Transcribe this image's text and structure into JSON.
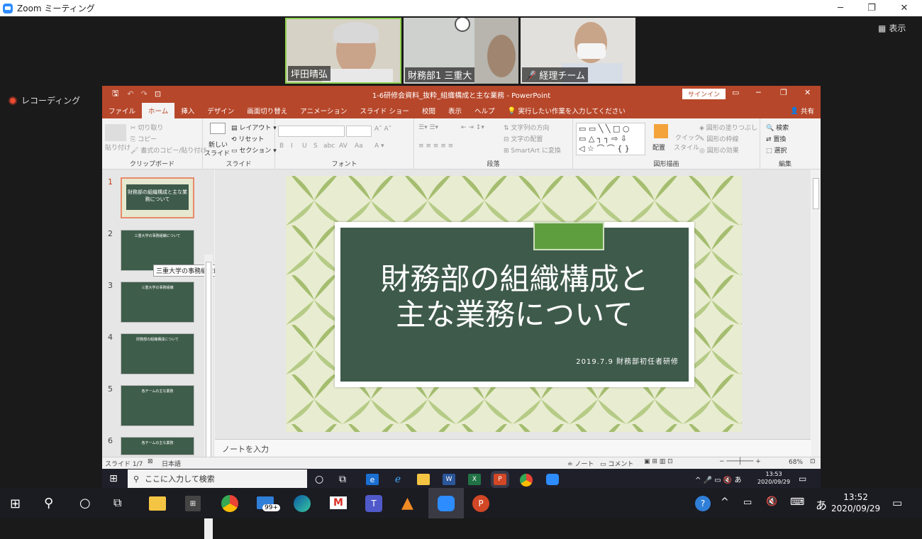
{
  "zoom": {
    "title": "Zoom ミーティング",
    "view_button": "表示",
    "recording": "レコーディング"
  },
  "participants": [
    {
      "name": "坪田晴弘"
    },
    {
      "name": "財務部1 三重大"
    },
    {
      "name": "経理チーム"
    }
  ],
  "pp": {
    "doc_title": "1-6研修会資料_抜粋_組織構成と主な業務  -  PowerPoint",
    "signin": "サインイン",
    "tabs": [
      "ファイル",
      "ホーム",
      "挿入",
      "デザイン",
      "画面切り替え",
      "アニメーション",
      "スライド ショー",
      "校閲",
      "表示",
      "ヘルプ"
    ],
    "tellme": "実行したい作業を入力してください",
    "share": "共有",
    "ribbon": {
      "clipboard": {
        "paste": "貼り付け",
        "cut": "切り取り",
        "copy": "コピー",
        "format_painter": "書式のコピー/貼り付け",
        "label": "クリップボード"
      },
      "slides": {
        "new_slide": "新しい",
        "new_slide2": "スライド",
        "layout": "レイアウト",
        "reset": "リセット",
        "section": "セクション",
        "label": "スライド"
      },
      "font": {
        "label": "フォント",
        "bold": "B",
        "italic": "I",
        "underline": "U",
        "shadow": "S",
        "strike": "abc",
        "spacing": "AV",
        "case": "Aa"
      },
      "paragraph": {
        "label": "段落",
        "text_dir": "文字列の方向",
        "align_text": "文字の配置",
        "smartart": "SmartArt に変換"
      },
      "drawing": {
        "label": "図形描画",
        "arrange": "配置",
        "quick": "クイック",
        "quick2": "スタイル",
        "fill": "図形の塗りつぶし",
        "outline": "図形の枠線",
        "effects": "図形の効果"
      },
      "editing": {
        "label": "編集",
        "find": "検索",
        "replace": "置換",
        "select": "選択"
      }
    },
    "thumbnails": [
      {
        "num": "1",
        "text": "財務部の組織構成と主な業務について"
      },
      {
        "num": "2",
        "text": "三重大学の事務組織について"
      },
      {
        "num": "3",
        "text": "三重大学の事務組織"
      },
      {
        "num": "4",
        "text": "財務部の組織構成について"
      },
      {
        "num": "5",
        "text": "各チームの主な業務"
      },
      {
        "num": "6",
        "text": "各チームの主な業務"
      }
    ],
    "tooltip": "三重大学の事務組織について",
    "slide": {
      "title_line1": "財務部の組織構成と",
      "title_line2": "主な業務について",
      "subtitle": "2019.7.9  財務部初任者研修"
    },
    "notes_placeholder": "ノートを入力",
    "status": {
      "slide": "スライド 1/7",
      "lang": "日本語",
      "notes": "ノート",
      "comments": "コメント",
      "zoom": "68%"
    }
  },
  "inner_taskbar": {
    "search": "ここに入力して検索",
    "time": "13:53",
    "date": "2020/09/29"
  },
  "taskbar": {
    "mail_badge": "99+",
    "ime": "あ",
    "time": "13:52",
    "date": "2020/09/29"
  }
}
